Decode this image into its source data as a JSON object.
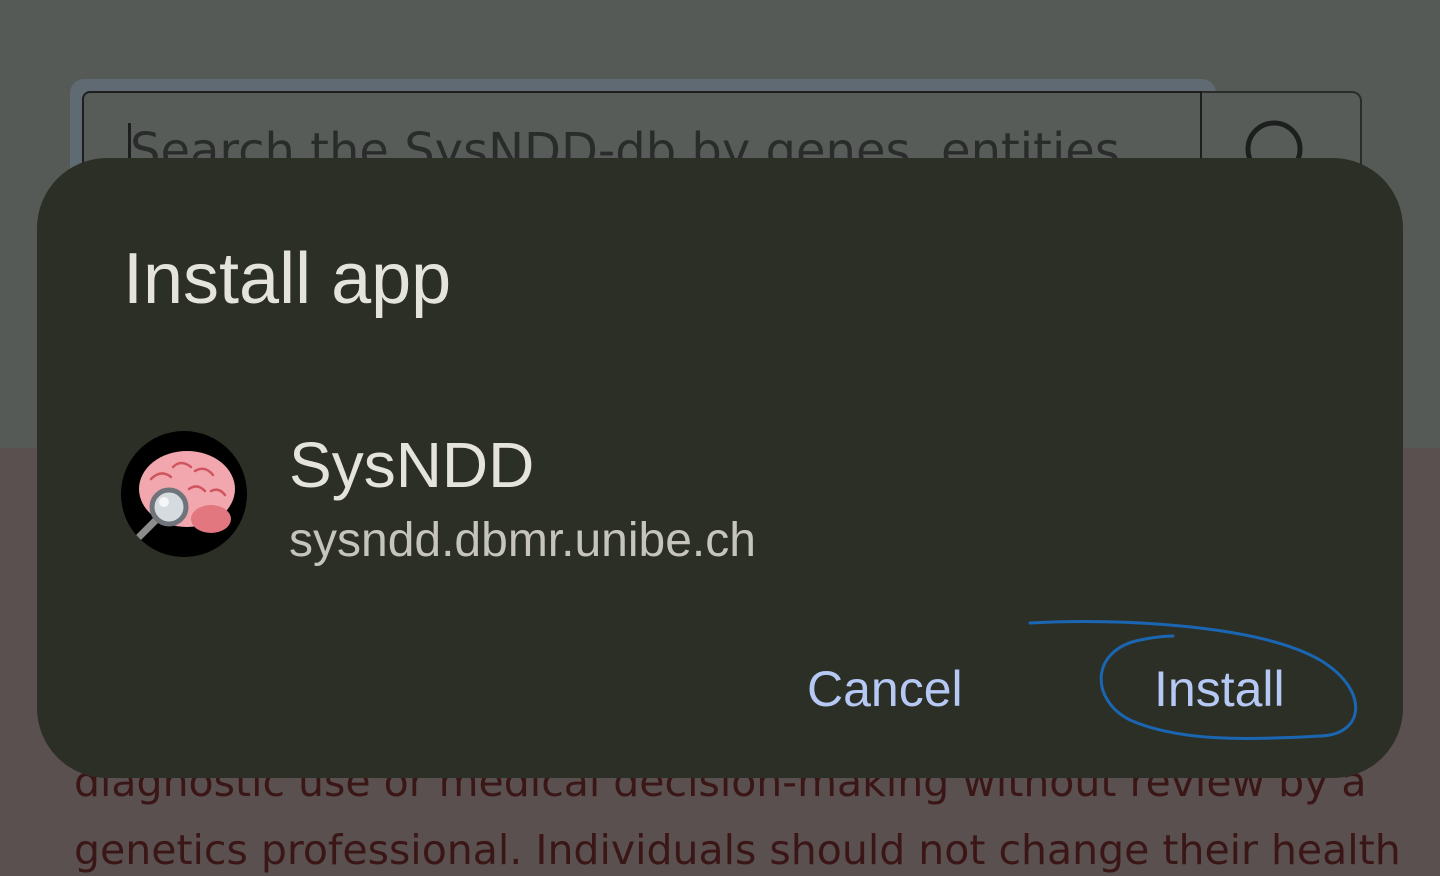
{
  "search": {
    "placeholder": "Search the SysNDD-db by genes, entities"
  },
  "background_text": {
    "line1": "diagnostic use or medical decision-making without review by a",
    "line2": "genetics professional. Individuals should not change their health"
  },
  "dialog": {
    "title": "Install app",
    "app_name": "SysNDD",
    "app_url": "sysndd.dbmr.unibe.ch",
    "cancel_label": "Cancel",
    "install_label": "Install"
  },
  "icons": {
    "search": "search-icon",
    "app": "brain-magnifier-icon"
  },
  "colors": {
    "dialog_bg": "#2c2f26",
    "button_text": "#b6c8f4",
    "annotation_stroke": "#1a66b3"
  }
}
